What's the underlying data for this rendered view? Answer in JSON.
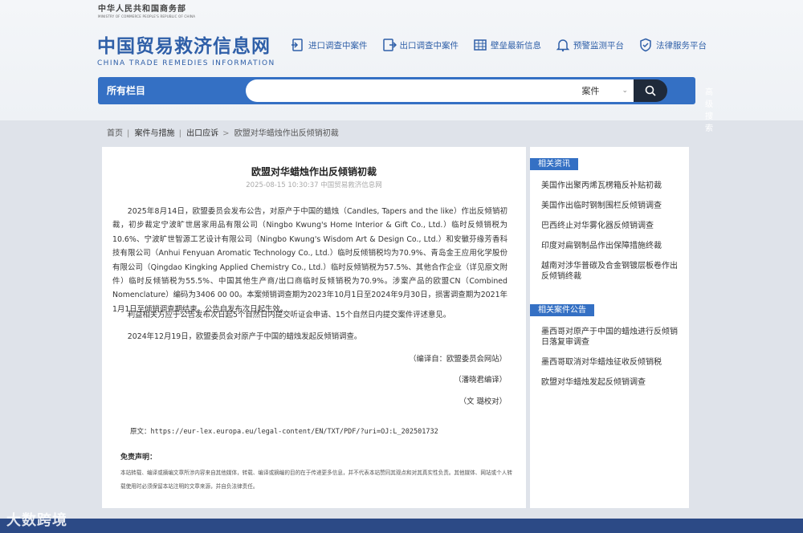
{
  "ministry": {
    "name_cn": "中华人民共和国商务部",
    "name_en": "MINISTRY OF COMMERCE PEOPLE'S REPUBLIC OF CHINA"
  },
  "site": {
    "name_cn": "中国贸易救济信息网",
    "name_en": "CHINA TRADE REMEDIES INFORMATION"
  },
  "topnav": [
    {
      "label": "进口调查中案件",
      "icon": "import-doc-icon"
    },
    {
      "label": "出口调查中案件",
      "icon": "export-doc-icon"
    },
    {
      "label": "壁垒最新信息",
      "icon": "barrier-icon"
    },
    {
      "label": "预警监测平台",
      "icon": "bell-icon"
    },
    {
      "label": "法律服务平台",
      "icon": "shield-icon"
    }
  ],
  "search": {
    "category_label": "所有栏目",
    "placeholder": "",
    "type_label": "案件",
    "advanced_label": "高级搜索"
  },
  "breadcrumb": [
    "首页",
    "案件与措施",
    "出口应诉",
    "欧盟对华蜡烛作出反倾销初裁"
  ],
  "article": {
    "title": "欧盟对华蜡烛作出反倾销初裁",
    "meta": "2025-08-15 10:30:37 中国贸易救济信息网",
    "body": "2025年8月14日，欧盟委员会发布公告，对原产于中国的蜡烛（Candles, Tapers and the like）作出反倾销初裁，初步裁定宁波旷世居家用品有限公司（Ningbo Kwung's Home Interior & Gift Co., Ltd.）临时反倾销税为10.6%、宁波旷世智源工艺设计有限公司（Ningbo Kwung's Wisdom Art & Design Co., Ltd.）和安徽芬缘芳香科技有限公司（Anhui Fenyuan Aromatic Technology Co., Ltd.）临时反倾销税均为70.9%、青岛金王应用化学股份有限公司（Qingdao Kingking Applied Chemistry Co., Ltd.）临时反倾销税为57.5%、其他合作企业（详见原文附件）临时反倾销税为55.5%、中国其他生产商/出口商临时反倾销税为70.9%。涉案产品的欧盟CN（Combined Nomenclature）编码为3406 00 00。本案倾销调查期为2023年10月1日至2024年9月30日，损害调查期为2021年1月1日至倾销调查期结束。公告自发布次日起生效。",
    "para2": "利益相关方应于公告发布次日起5个自然日内提交听证会申请、15个自然日内提交案件评述意见。",
    "para3": "2024年12月19日，欧盟委员会对原产于中国的蜡烛发起反倾销调查。",
    "sign1": "（编译自：欧盟委员会网站）",
    "sign2": "（潘晓君编译）",
    "sign3": "（文 璐校对）",
    "source": "原文：https://eur-lex.europa.eu/legal-content/EN/TXT/PDF/?uri=OJ:L_202501732",
    "disclaimer_title": "免责声明：",
    "disclaimer_body": "本站转载、编译或摘编文章所涉内容来自其他媒体，转载、编译或摘编的目的在于传递更多信息，并不代表本站赞同其观点和对其真实性负责。其他媒体、网站或个人转载使用时必须保留本站注明的文章来源，并自负法律责任。"
  },
  "sidebar": {
    "news_title": "相关资讯",
    "news": [
      "美国作出聚丙烯瓦楞箱反补贴初裁",
      "美国作出临时钢制围栏反倾销调查",
      "巴西终止对华雾化器反倾销调查",
      "印度对扁钢制品作出保障措施终裁",
      "越南对涉华普碳及合金钢镀层板卷作出反倾销终裁"
    ],
    "cases_title": "相关案件公告",
    "cases": [
      "墨西哥对原产于中国的蜡烛进行反倾销日落复审调查",
      "墨西哥取消对华蜡烛征收反倾销税",
      "欧盟对华蜡烛发起反倾销调查"
    ]
  },
  "watermark": "大数跨境"
}
